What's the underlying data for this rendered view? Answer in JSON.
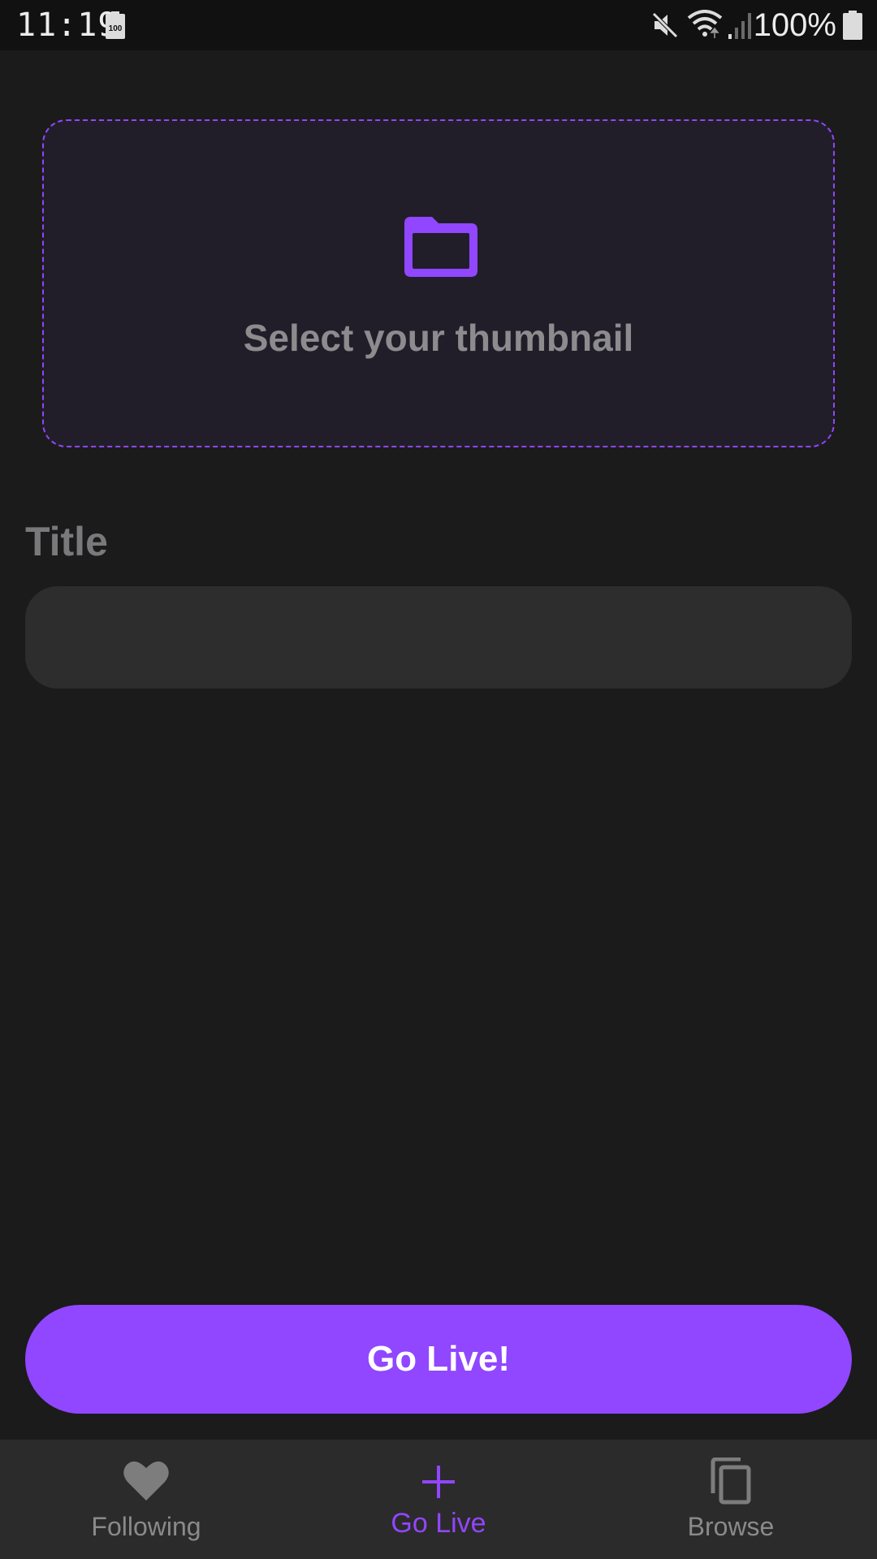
{
  "status_bar": {
    "time": "11:19",
    "battery_percent": "100%",
    "battery_saver_label": "100",
    "icons": [
      "battery-saver-icon",
      "mute-icon",
      "wifi-icon",
      "signal-icon",
      "battery-icon"
    ]
  },
  "thumbnail": {
    "icon": "folder-icon",
    "label": "Select your thumbnail"
  },
  "title_field": {
    "label": "Title",
    "value": "",
    "placeholder": ""
  },
  "go_live_button": {
    "label": "Go Live!"
  },
  "bottom_nav": {
    "items": [
      {
        "label": "Following",
        "icon": "heart-icon",
        "active": false
      },
      {
        "label": "Go Live",
        "icon": "plus-icon",
        "active": true
      },
      {
        "label": "Browse",
        "icon": "copy-icon",
        "active": false
      }
    ]
  },
  "colors": {
    "accent": "#9146ff",
    "background": "#1b1b1b",
    "surface": "#2d2d2d",
    "nav_background": "#2b2b2b",
    "muted_text": "#8a8a8a"
  }
}
